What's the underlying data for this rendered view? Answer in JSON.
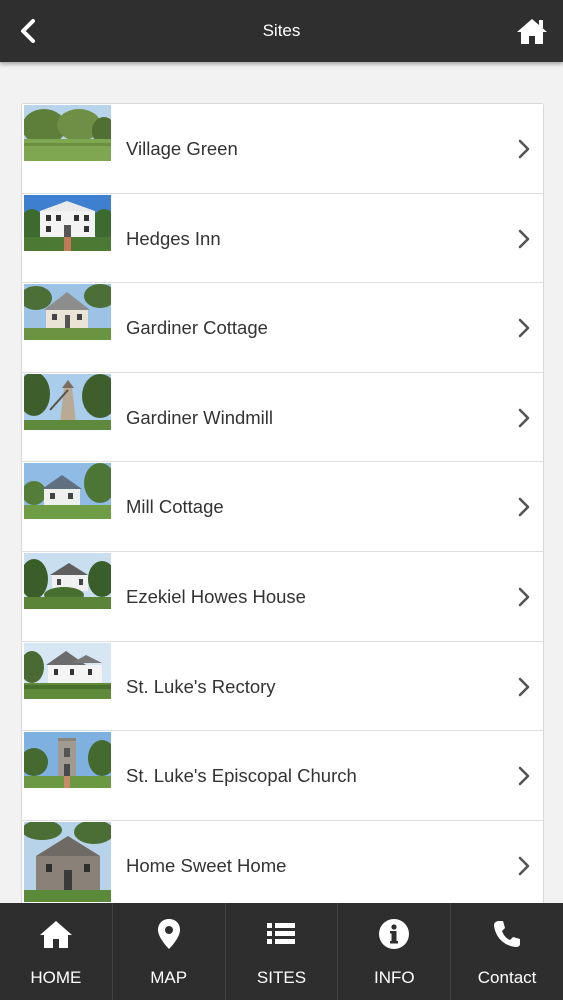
{
  "header": {
    "title": "Sites"
  },
  "sites": [
    {
      "name": "Village Green",
      "image": "village-green-photo"
    },
    {
      "name": "Hedges Inn",
      "image": "hedges-inn-photo"
    },
    {
      "name": "Gardiner Cottage",
      "image": "gardiner-cottage-photo"
    },
    {
      "name": "Gardiner Windmill",
      "image": "gardiner-windmill-photo"
    },
    {
      "name": "Mill Cottage",
      "image": "mill-cottage-photo"
    },
    {
      "name": "Ezekiel Howes House",
      "image": "ezekiel-howes-house-photo"
    },
    {
      "name": "St. Luke's Rectory",
      "image": "st-lukes-rectory-photo"
    },
    {
      "name": "St. Luke's Episcopal Church",
      "image": "st-lukes-church-photo"
    },
    {
      "name": "Home Sweet Home",
      "image": "home-sweet-home-photo"
    }
  ],
  "tabbar": {
    "tabs": [
      {
        "label": "HOME",
        "icon": "home-icon"
      },
      {
        "label": "MAP",
        "icon": "map-pin-icon"
      },
      {
        "label": "SITES",
        "icon": "list-icon"
      },
      {
        "label": "INFO",
        "icon": "info-icon"
      },
      {
        "label": "Contact",
        "icon": "phone-icon"
      }
    ]
  },
  "colors": {
    "bar": "#2e2e2e",
    "text": "#333333",
    "background": "#f2f2f2"
  }
}
